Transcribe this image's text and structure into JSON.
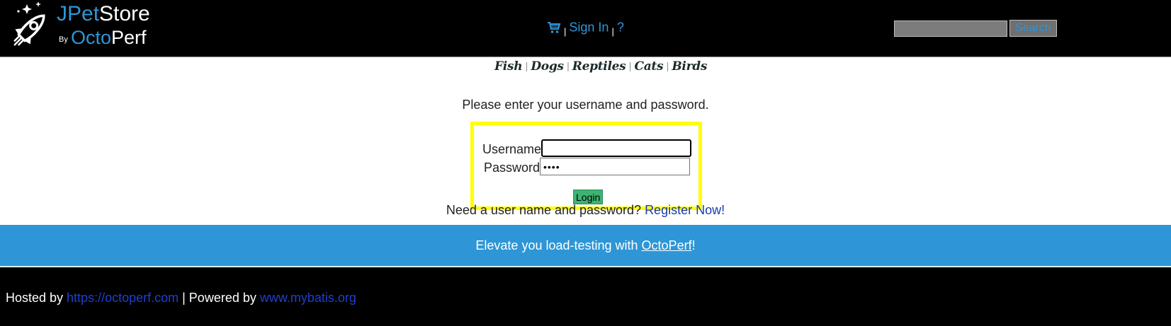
{
  "header": {
    "logo": {
      "title_part1": "JPet",
      "title_part2": "Store",
      "by": "By",
      "brand_part1": "Octo",
      "brand_part2": "Perf"
    },
    "menu": {
      "cart_icon": "shopping-cart-icon",
      "sign_in": "Sign In",
      "help": "?",
      "separator": "|"
    },
    "search": {
      "value": "",
      "button_label": "Search"
    }
  },
  "quicklinks": {
    "items": [
      {
        "label": "Fish"
      },
      {
        "label": "Dogs"
      },
      {
        "label": "Reptiles"
      },
      {
        "label": "Cats"
      },
      {
        "label": "Birds"
      }
    ],
    "separator": "|"
  },
  "login": {
    "prompt": "Please enter your username and password.",
    "username_label": "Username:",
    "username_value": "",
    "password_label": "Password:",
    "password_value": "••••",
    "button_label": "Login",
    "highlight_color": "#ffff00"
  },
  "register": {
    "text": "Need a user name and password? ",
    "link": "Register Now!"
  },
  "banner": {
    "text": "Elevate you load-testing with ",
    "link": "OctoPerf",
    "suffix": "!",
    "color": "#2e96d6"
  },
  "footer": {
    "hosted_by": "Hosted by ",
    "hosted_link": "https://octoperf.com",
    "powered_by": " | Powered by ",
    "powered_link": "www.mybatis.org"
  }
}
